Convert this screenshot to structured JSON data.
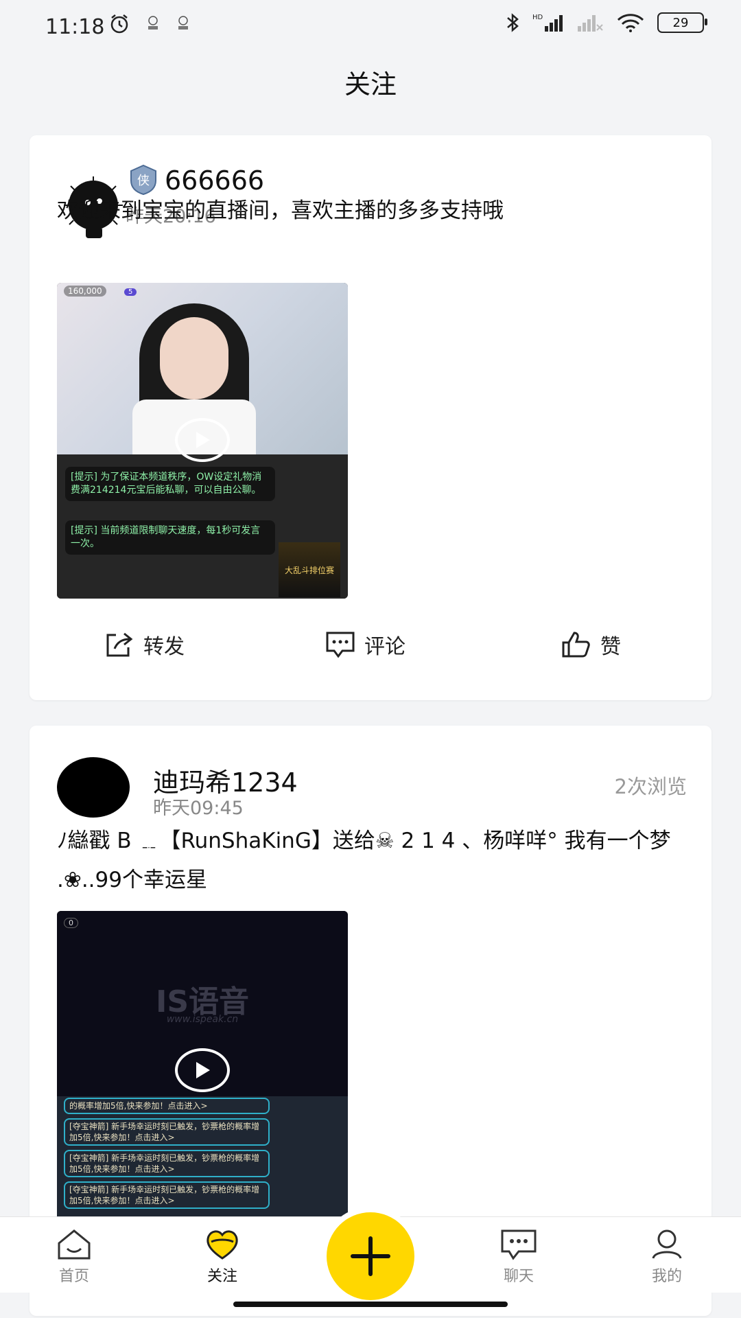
{
  "status_bar": {
    "time": "11:18",
    "hd": "HD",
    "battery": "29"
  },
  "header": {
    "title": "关注"
  },
  "posts": [
    {
      "username": "666666",
      "badge": "侠",
      "time": "昨天20:16",
      "text": "欢迎来到宝宝的直播间，喜欢主播的多多支持哦",
      "media": {
        "viewer_count": "160,000",
        "level": "5",
        "tip1": "[提示] 为了保证本频道秩序，OW设定礼物消费满214214元宝后能私聊，可以自由公聊。",
        "tip2": "[提示] 当前频道限制聊天速度，每1秒可发言一次。",
        "ad": "大乱斗排位赛"
      },
      "actions": {
        "share": "转发",
        "comment": "评论",
        "like": "赞"
      }
    },
    {
      "username": "迪玛希1234",
      "time": "昨天09:45",
      "views": "2次浏览",
      "text": "ﾉ䜌戳 B ﹎【RunShaKinG】送给☠ 2 1 4 、杨咩咩° 我有一个梦 .❀..99个幸运星",
      "media": {
        "counter": "0",
        "watermark": "IS语音",
        "watermark_url": "www.ispeak.cn",
        "chat": [
          "的概率增加5倍,快来参加！点击进入>",
          "[夺宝神箭] 新手场幸运时刻已触发，钞票枪的概率增加5倍,快来参加！点击进入>",
          "[夺宝神箭] 新手场幸运时刻已触发，钞票枪的概率增加5倍,快来参加！点击进入>",
          "[夺宝神箭] 新手场幸运时刻已触发，钞票枪的概率增加5倍,快来参加！点击进入>"
        ]
      }
    }
  ],
  "tabbar": {
    "home": "首页",
    "follow": "关注",
    "chat": "聊天",
    "me": "我的"
  },
  "colors": {
    "accent": "#ffd700",
    "text": "#111111",
    "muted": "#888888"
  }
}
